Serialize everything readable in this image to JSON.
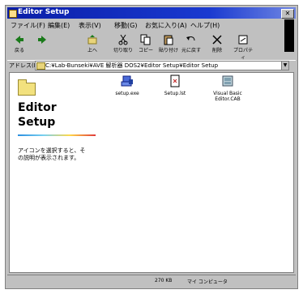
{
  "window": {
    "title": "Editor Setup"
  },
  "menu": [
    "ファイル(F)",
    "編集(E)",
    "表示(V)",
    "移動(G)",
    "お気に入り(A)",
    "ヘルプ(H)"
  ],
  "toolbar": [
    {
      "label": "戻る",
      "icon": "back-icon"
    },
    {
      "label": "",
      "icon": "forward-icon"
    },
    {
      "label": "上へ",
      "icon": "up-icon"
    },
    {
      "label": "切り取り",
      "icon": "cut-icon"
    },
    {
      "label": "コピー",
      "icon": "copy-icon"
    },
    {
      "label": "貼り付け",
      "icon": "paste-icon"
    },
    {
      "label": "元に戻す",
      "icon": "undo-icon"
    },
    {
      "label": "削除",
      "icon": "delete-icon"
    },
    {
      "label": "プロパティ",
      "icon": "properties-icon"
    }
  ],
  "address": {
    "label": "アドレス(D)",
    "value": "C:¥Lab-Bunseki¥AVE 解析器 DOS2¥Editor Setup¥Editor Setup"
  },
  "sidebar": {
    "title": "Editor Setup",
    "description": "アイコンを選択すると、その説明が表示されます。"
  },
  "files": [
    {
      "name": "setup.exe",
      "icon": "setup-exe-icon"
    },
    {
      "name": "Setup.lst",
      "icon": "setup-lst-icon"
    },
    {
      "name": "Visual Basic Editor.CAB",
      "icon": "cab-file-icon"
    }
  ],
  "status": {
    "left": "270 KB",
    "right": "マイ コンピュータ"
  }
}
